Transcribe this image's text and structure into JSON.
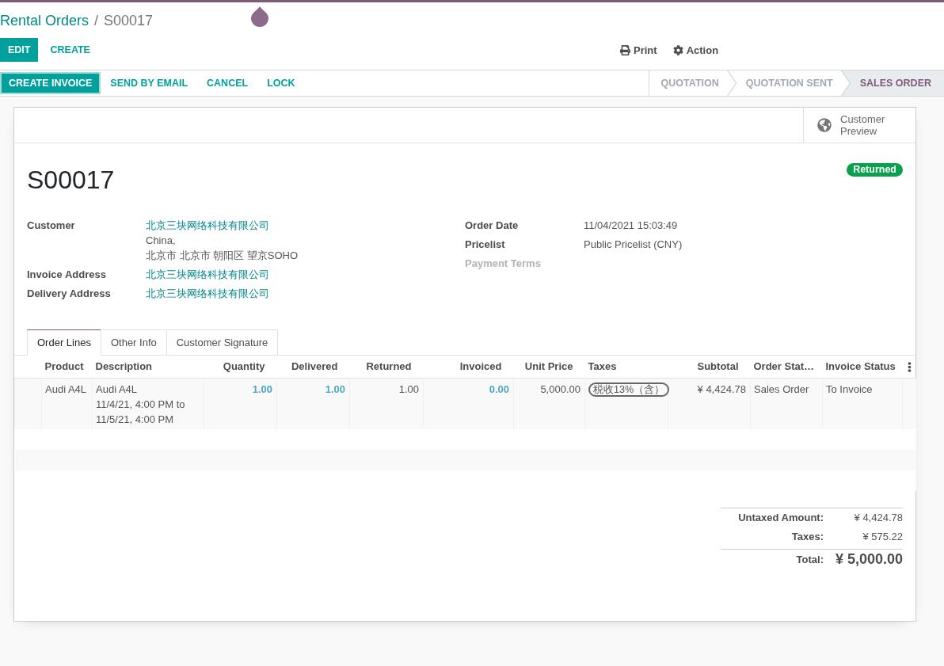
{
  "breadcrumb": {
    "items": [
      {
        "label": "Rental Orders",
        "kind": "link"
      },
      {
        "label": "S00017",
        "kind": "current"
      }
    ],
    "separator": "/"
  },
  "control_panel": {
    "buttons": [
      {
        "label": "EDIT",
        "kind": "primary"
      },
      {
        "label": "CREATE",
        "kind": "secondary"
      }
    ],
    "menus": [
      {
        "label": "Print"
      },
      {
        "label": "Action"
      }
    ]
  },
  "status_bar": {
    "buttons": [
      {
        "label": "CREATE INVOICE",
        "kind": "primary",
        "focused": true
      },
      {
        "label": "SEND BY EMAIL",
        "kind": "secondary",
        "focused": false
      },
      {
        "label": "CANCEL",
        "kind": "secondary",
        "focused": false
      },
      {
        "label": "LOCK",
        "kind": "secondary",
        "focused": false
      }
    ],
    "stages": [
      {
        "label": "QUOTATION",
        "selected": false
      },
      {
        "label": "QUOTATION SENT",
        "selected": false
      },
      {
        "label": "SALES ORDER",
        "selected": true
      }
    ]
  },
  "sheet": {
    "button_box": [
      {
        "label": "Customer Preview"
      }
    ],
    "title": "S00017",
    "status_badge": "Returned",
    "fields_left": [
      {
        "label": "Customer",
        "value": "北京三块网络科技有限公司",
        "kind": "link",
        "address": "China,\n北京市 北京市 朝阳区 望京SOHO",
        "empty": false
      },
      {
        "label": "Invoice Address",
        "value": "北京三块网络科技有限公司",
        "kind": "link",
        "empty": false
      },
      {
        "label": "Delivery Address",
        "value": "北京三块网络科技有限公司",
        "kind": "link",
        "empty": false
      }
    ],
    "fields_right": [
      {
        "label": "Order Date",
        "value": "11/04/2021 15:03:49",
        "kind": "text",
        "empty": false
      },
      {
        "label": "Pricelist",
        "value": "Public Pricelist (CNY)",
        "kind": "text",
        "empty": false
      },
      {
        "label": "Payment Terms",
        "empty": true
      }
    ],
    "tabs": [
      {
        "label": "Order Lines",
        "selected": true
      },
      {
        "label": "Other Info",
        "selected": false
      },
      {
        "label": "Customer Signature",
        "selected": false
      }
    ],
    "order_lines": {
      "columns": [
        {
          "label": "Product",
          "kind": "text"
        },
        {
          "label": "Description",
          "kind": "text"
        },
        {
          "label": "Quantity",
          "kind": "number"
        },
        {
          "label": "Delivered",
          "kind": "number"
        },
        {
          "label": "Returned",
          "kind": "number"
        },
        {
          "label": "Invoiced",
          "kind": "number"
        },
        {
          "label": "Unit Price",
          "kind": "number"
        },
        {
          "label": "Taxes",
          "kind": "text"
        },
        {
          "label": "Subtotal",
          "kind": "number"
        },
        {
          "label": "Order Stat…",
          "kind": "text"
        },
        {
          "label": "Invoice Status",
          "kind": "text"
        }
      ],
      "rows": [
        {
          "cells": [
            {
              "text": "Audi A4L",
              "kind": "plain"
            },
            {
              "text": "Audi A4L\n11/4/21, 4:00 PM to\n11/5/21, 4:00 PM",
              "kind": "plain"
            },
            {
              "text": "1.00",
              "kind": "info"
            },
            {
              "text": "1.00",
              "kind": "info"
            },
            {
              "text": "1.00",
              "kind": "plain"
            },
            {
              "text": "0.00",
              "kind": "info"
            },
            {
              "text": "5,000.00",
              "kind": "plain"
            },
            {
              "text": "税收13%（含）",
              "kind": "tag"
            },
            {
              "text": "¥ 4,424.78",
              "kind": "plain"
            },
            {
              "text": "Sales Order",
              "kind": "plain"
            },
            {
              "text": "To Invoice",
              "kind": "plain"
            }
          ]
        }
      ]
    },
    "totals": [
      {
        "label": "Untaxed Amount:",
        "value": "¥ 4,424.78",
        "kind": "subtotal"
      },
      {
        "label": "Taxes:",
        "value": "¥ 575.22",
        "kind": "subtotal"
      },
      {
        "label": "Total:",
        "value": "¥ 5,000.00",
        "kind": "grand"
      }
    ]
  }
}
